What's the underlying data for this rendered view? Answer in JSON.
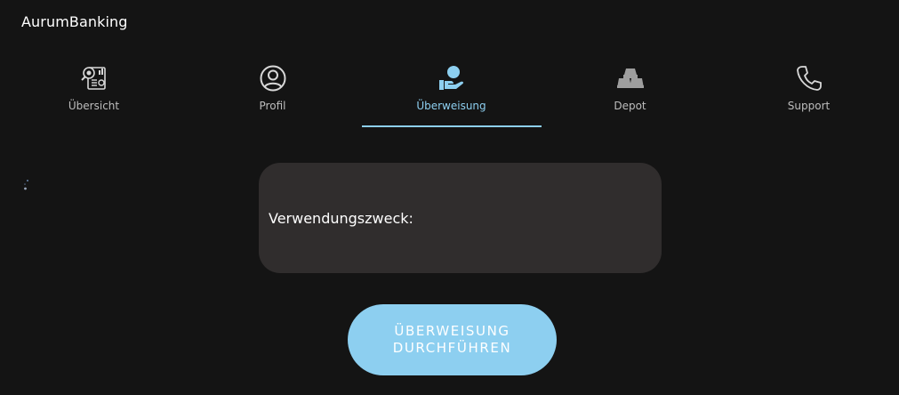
{
  "app": {
    "title": "AurumBanking",
    "background": "#141414",
    "accent": "#8dcff0"
  },
  "nav": {
    "active_index": 2,
    "tabs": [
      {
        "label": "Übersicht",
        "icon": "dashboard-report-icon"
      },
      {
        "label": "Profil",
        "icon": "user-circle-icon"
      },
      {
        "label": "Überweisung",
        "icon": "hand-money-transfer-icon"
      },
      {
        "label": "Depot",
        "icon": "gold-bars-icon"
      },
      {
        "label": "Support",
        "icon": "phone-icon"
      }
    ]
  },
  "form": {
    "purpose_label": "Verwendungszweck:",
    "submit_line1": "ÜBERWEISUNG",
    "submit_line2": "DURCHFÜHREN"
  }
}
